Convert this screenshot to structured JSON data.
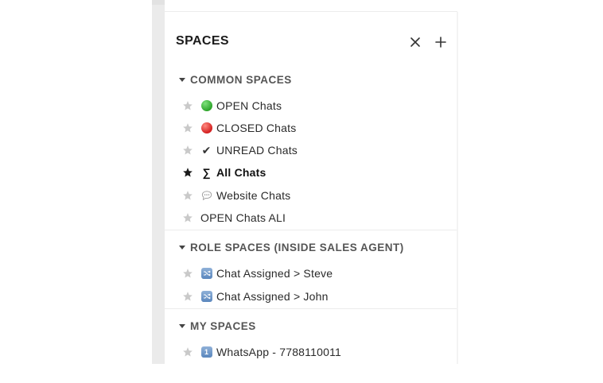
{
  "panel": {
    "title": "SPACES",
    "icons": {
      "close": "close-icon",
      "add": "plus-icon",
      "star": "star-icon"
    }
  },
  "sections": [
    {
      "label": "COMMON SPACES",
      "items": [
        {
          "label": "OPEN Chats",
          "icon": "green-circle-icon",
          "starred": false
        },
        {
          "label": "CLOSED Chats",
          "icon": "red-circle-icon",
          "starred": false
        },
        {
          "label": "UNREAD Chats",
          "icon": "checkmark-icon",
          "glyph": "✔",
          "starred": false
        },
        {
          "label": "All Chats",
          "icon": "sigma-icon",
          "glyph": "∑",
          "starred": true,
          "active": true
        },
        {
          "label": "Website Chats",
          "icon": "speech-bubble-icon",
          "starred": false
        },
        {
          "label": "OPEN Chats ALI",
          "icon": "",
          "starred": false
        }
      ]
    },
    {
      "label": "ROLE SPACES (INSIDE SALES AGENT)",
      "items": [
        {
          "label": "Chat Assigned > Steve",
          "icon": "shuffle-icon",
          "starred": false
        },
        {
          "label": "Chat Assigned > John",
          "icon": "shuffle-icon",
          "starred": false
        }
      ]
    },
    {
      "label": "MY SPACES",
      "items": [
        {
          "label": "WhatsApp - 7788110011",
          "icon": "keycap-one-icon",
          "glyph": "1",
          "starred": false
        }
      ]
    }
  ],
  "colors": {
    "star_inactive": "#c9c9c9",
    "star_active": "#1a1a1a",
    "divider": "#ececec",
    "section_label": "#555555"
  }
}
